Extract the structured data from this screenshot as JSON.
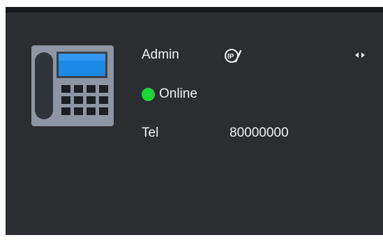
{
  "contact": {
    "name": "Admin",
    "status": "Online",
    "tel_label": "Tel",
    "tel_value": "80000000"
  },
  "icons": {
    "device": "desk-phone-icon",
    "ip_edit": "ip-edit-icon",
    "expand": "expand-horizontal-icon",
    "status": "online-status-dot"
  },
  "colors": {
    "panel_bg": "#2b2d31",
    "text": "#f2f2f2",
    "online": "#1dd63b",
    "screen": "#1e88e5"
  }
}
